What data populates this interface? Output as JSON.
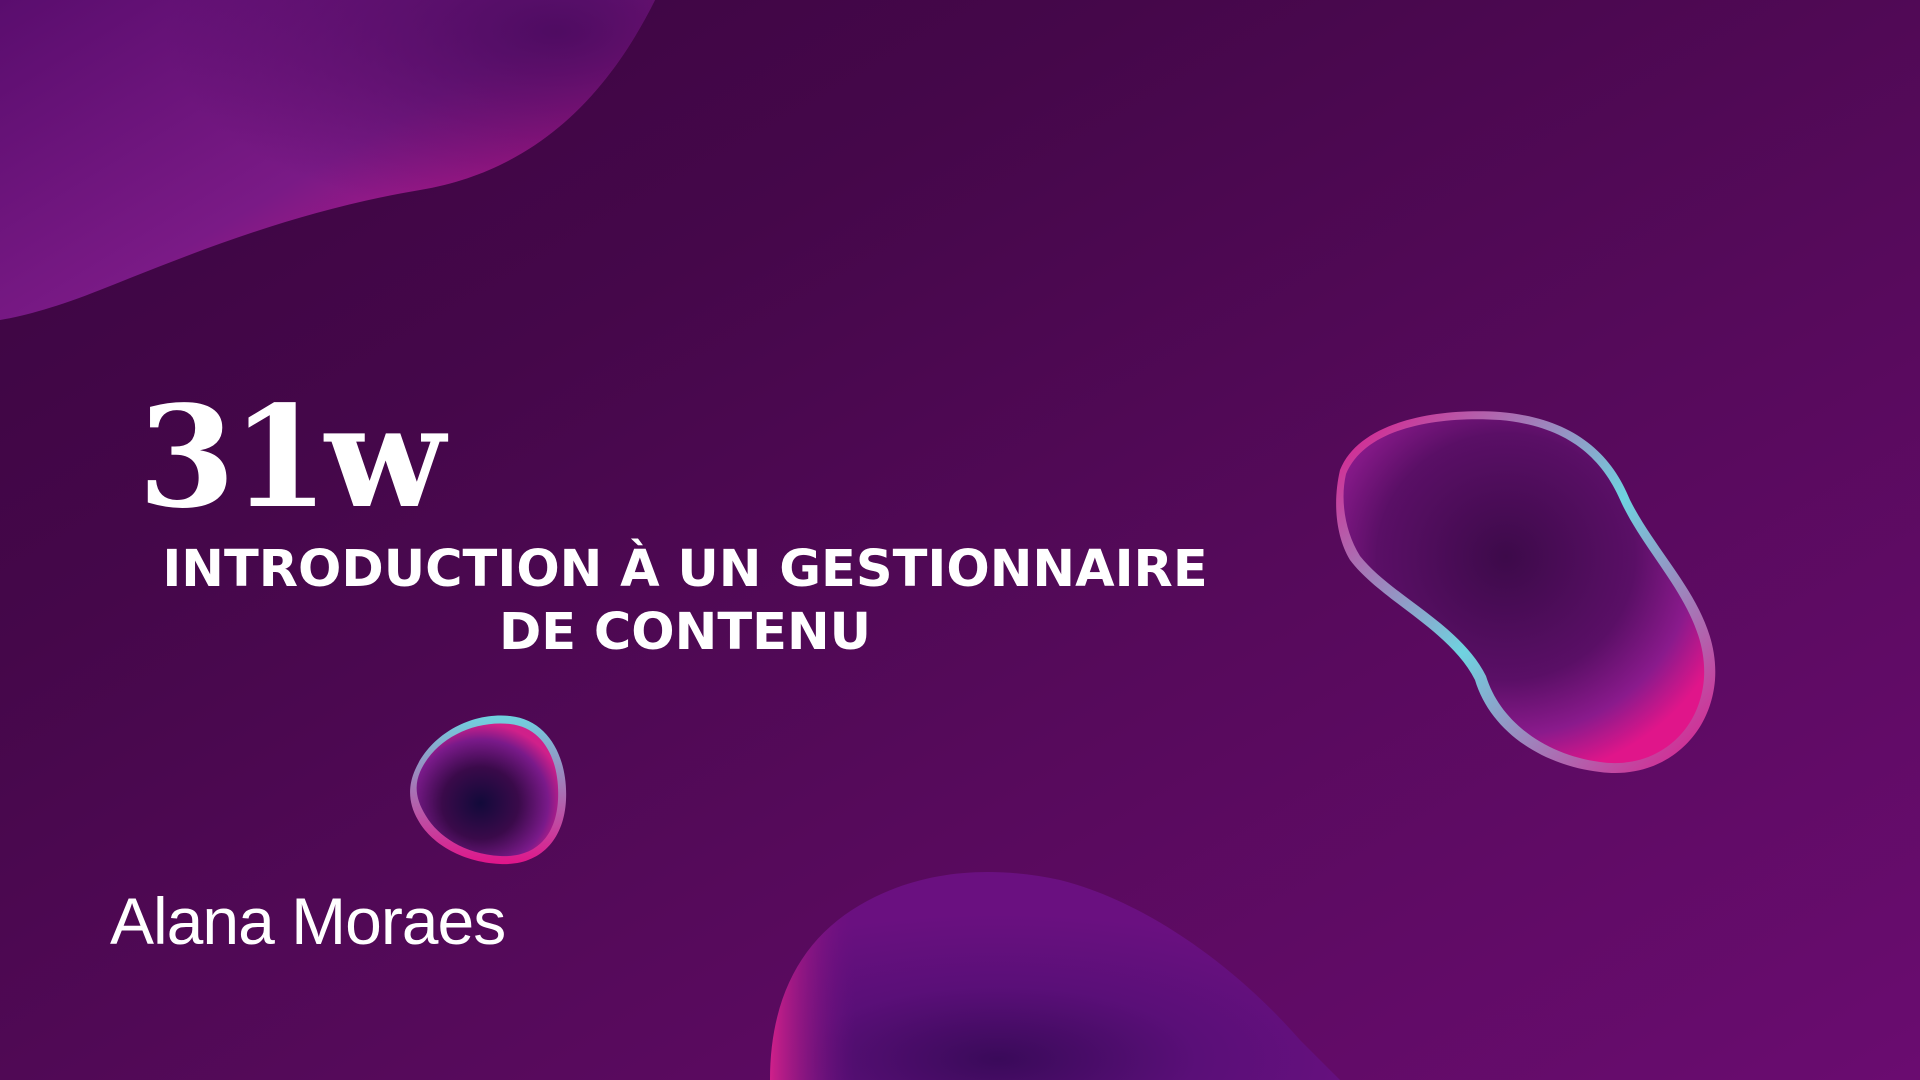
{
  "slide": {
    "logo_text": "31w",
    "title": "INTRODUCTION À UN GESTIONNAIRE DE CONTENU",
    "author": "Alana Moraes"
  },
  "colors": {
    "background_dark": "#3a0540",
    "background_light": "#6a0c70",
    "accent_pink": "#e0158a",
    "accent_cyan": "#6fd3e0",
    "text": "#ffffff"
  },
  "icons": [
    "blob-top-left",
    "blob-right",
    "blob-small",
    "blob-bottom"
  ]
}
